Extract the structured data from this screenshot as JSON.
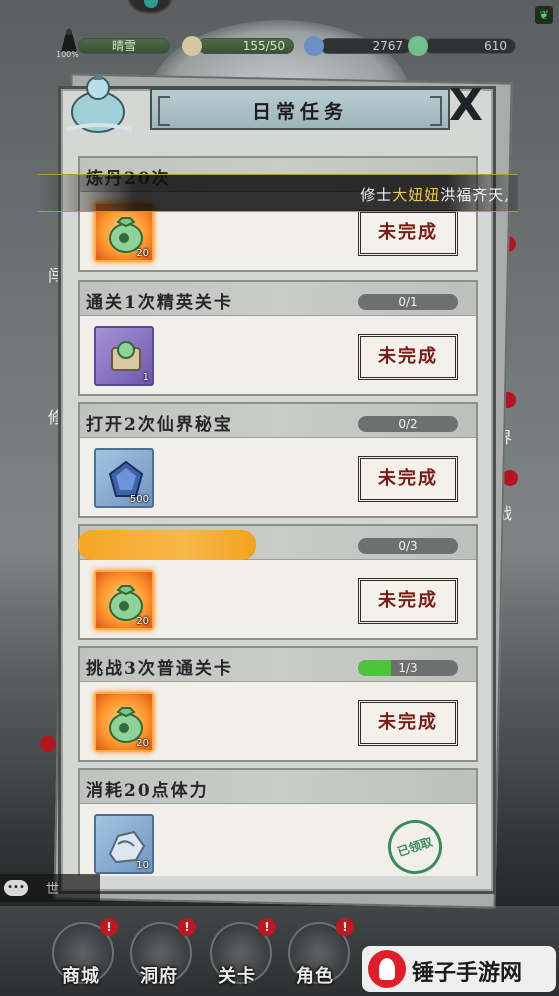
{
  "resources": {
    "player_name": "晴雪",
    "player_percent": "100%",
    "stamina": "155/50",
    "spirit_stone": "2767",
    "jade": "610"
  },
  "modal": {
    "title": "日常任务",
    "close_label": "X"
  },
  "scroll_message": {
    "prefix": "修士",
    "highlight": "大妞妞",
    "suffix": "洪福齐天,"
  },
  "tasks": [
    {
      "name": "炼丹20次",
      "progress_text": "",
      "progress_value": 0,
      "reward_count": "20",
      "reward_icon": "jade-bag-icon",
      "status": "未完成"
    },
    {
      "name": "通关1次精英关卡",
      "progress_text": "0/1",
      "progress_value": 0,
      "reward_count": "1",
      "reward_icon": "scroll-icon",
      "status": "未完成"
    },
    {
      "name": "打开2次仙界秘宝",
      "progress_text": "0/2",
      "progress_value": 0,
      "reward_count": "500",
      "reward_icon": "crystal-icon",
      "status": "未完成"
    },
    {
      "name": "",
      "progress_text": "0/3",
      "progress_value": 0,
      "reward_count": "20",
      "reward_icon": "jade-bag-icon",
      "status": "未完成"
    },
    {
      "name": "挑战3次普通关卡",
      "progress_text": "1/3",
      "progress_value": 0.3333,
      "reward_count": "20",
      "reward_icon": "jade-bag-icon",
      "status": "未完成"
    },
    {
      "name": "消耗20点体力",
      "progress_text": "",
      "progress_value": 1,
      "reward_count": "10",
      "reward_icon": "ore-icon",
      "status": "已领取"
    }
  ],
  "side_chars": [
    "闯",
    "修",
    "界",
    "战"
  ],
  "chat": {
    "label": "世"
  },
  "nav": [
    {
      "label": "商城"
    },
    {
      "label": "洞府"
    },
    {
      "label": "关卡"
    },
    {
      "label": "角色"
    }
  ],
  "badges": [
    "!",
    "!",
    "!",
    "!"
  ],
  "watermark": {
    "text": "锤子手游网"
  },
  "colors": {
    "accent_red": "#7a1b16",
    "progress_green": "#4bc43b",
    "gold": "#f0c74a"
  }
}
